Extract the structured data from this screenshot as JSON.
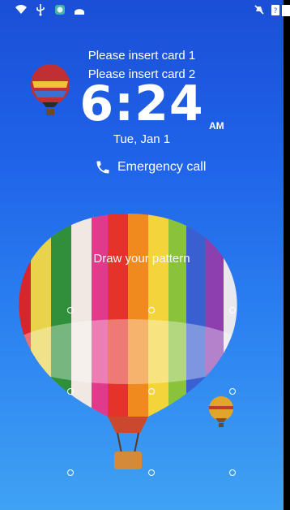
{
  "status_bar": {
    "left_icons": [
      "wifi-icon",
      "usb-icon",
      "app-icon",
      "android-debug-icon"
    ],
    "right_icons": [
      "mute-icon",
      "sim-question-icon",
      "battery-icon"
    ]
  },
  "lockscreen": {
    "messages": [
      "Please insert card 1",
      "Please insert card 2"
    ],
    "time": "6:24",
    "ampm": "AM",
    "date": "Tue, Jan 1",
    "emergency_label": "Emergency call",
    "pattern_prompt": "Draw your pattern"
  }
}
